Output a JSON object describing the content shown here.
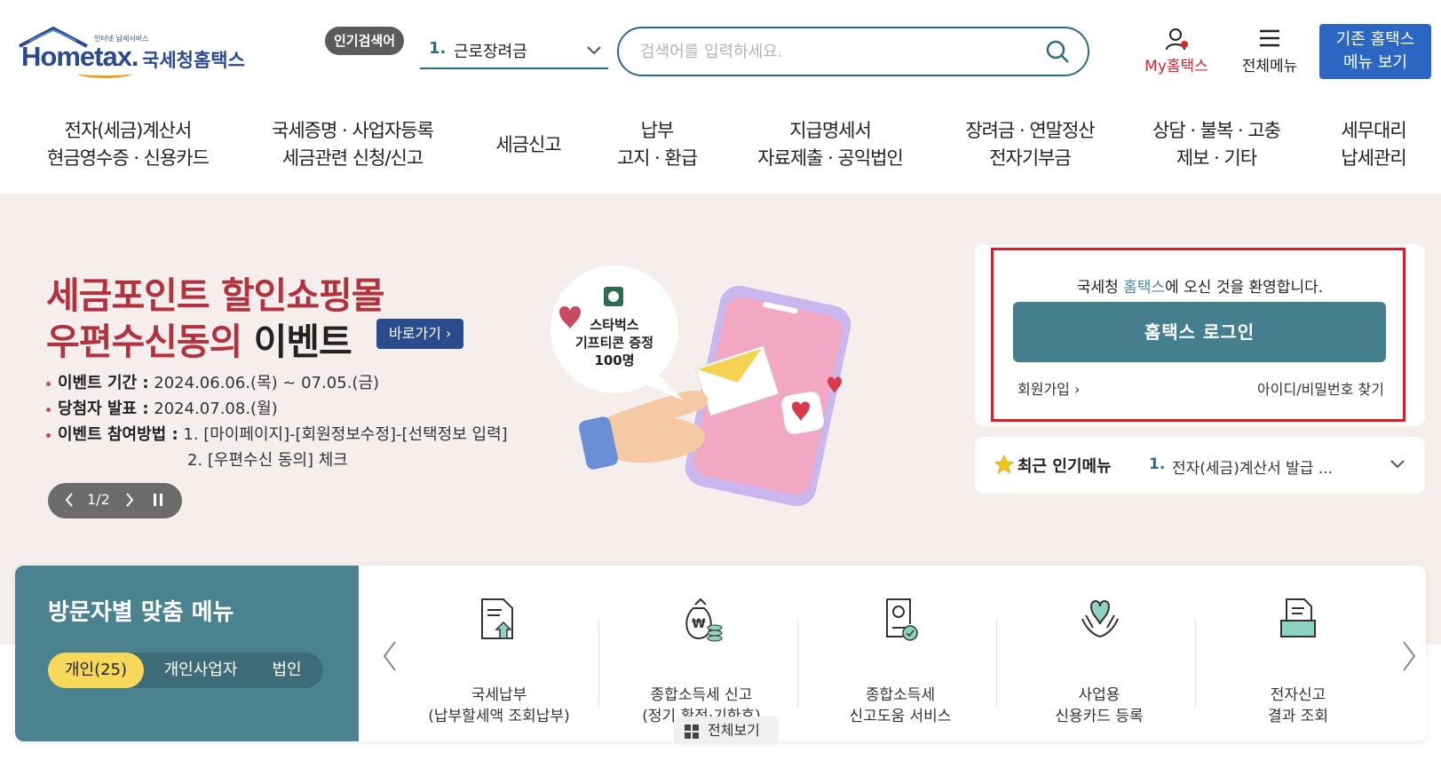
{
  "header": {
    "logo_small": "인터넷 납세서비스",
    "logo_word": "Hometax.",
    "logo_korean": "국세청홈택스",
    "popular_badge": "인기검색어",
    "popular_num": "1.",
    "popular_text": "근로장려금",
    "search_placeholder": "검색어를 입력하세요.",
    "my_label": "My홈택스",
    "allmenu_label": "전체메뉴",
    "old_line1": "기존 홈택스",
    "old_line2": "메뉴 보기"
  },
  "gnb": [
    {
      "l1": "전자(세금)계산서",
      "l2": "현금영수증 · 신용카드"
    },
    {
      "l1": "국세증명 · 사업자등록",
      "l2": "세금관련 신청/신고"
    },
    {
      "l1": "세금신고",
      "l2": ""
    },
    {
      "l1": "납부",
      "l2": "고지 · 환급"
    },
    {
      "l1": "지급명세서",
      "l2": "자료제출 · 공익법인"
    },
    {
      "l1": "장려금 · 연말정산",
      "l2": "전자기부금"
    },
    {
      "l1": "상담 · 불복 · 고충",
      "l2": "제보 · 기타"
    },
    {
      "l1": "세무대리",
      "l2": "납세관리"
    }
  ],
  "hero": {
    "title1": "세금포인트 할인쇼핑몰",
    "title2_red": "우편수신동의",
    "title2_dark": "이벤트",
    "go_label": "바로가기 ›",
    "period_label": "이벤트 기간 :",
    "period_value": "2024.06.06.(목) ~ 07.05.(금)",
    "winner_label": "당첨자 발표 :",
    "winner_value": "2024.07.08.(월)",
    "how_label": "이벤트 참여방법 :",
    "how_value1": "1. [마이페이지]-[회원정보수정]-[선택정보 입력]",
    "how_value2": "2. [우편수신 동의] 체크",
    "pager": "1/2",
    "bubble1": "스타벅스",
    "bubble2": "기프티콘 증정",
    "bubble3": "100명"
  },
  "login": {
    "welcome_pre": "국세청 ",
    "welcome_hl": "홈택스",
    "welcome_post": "에 오신 것을 환영합니다.",
    "login_button": "홈택스 로그인",
    "join": "회원가입 ›",
    "find": "아이디/비밀번호 찾기"
  },
  "recent": {
    "title": "최근 인기메뉴",
    "num": "1.",
    "text": "전자(세금)계산서 발급 ..."
  },
  "visitor": {
    "title": "방문자별 맞춤 메뉴",
    "tabs": [
      "개인(25)",
      "개인사업자",
      "법인"
    ],
    "services": [
      {
        "l1": "국세납부",
        "l2": "(납부할세액 조회납부)",
        "icon": "document-upload-icon"
      },
      {
        "l1": "종합소득세 신고",
        "l2": "(정기 확정·기한후)",
        "icon": "money-bag-icon"
      },
      {
        "l1": "종합소득세",
        "l2": "신고도움 서비스",
        "icon": "certificate-icon"
      },
      {
        "l1": "사업용",
        "l2": "신용카드 등록",
        "icon": "heart-hands-icon"
      },
      {
        "l1": "전자신고",
        "l2": "결과 조회",
        "icon": "document-tray-icon"
      }
    ],
    "view_all": "전체보기"
  },
  "colors": {
    "brand_blue": "#2a4b8d",
    "teal": "#457f8d",
    "hero_bg": "#f5eeed",
    "hero_red": "#b2333d",
    "highlight_red": "#e21b23",
    "tab_yellow": "#f7d85a"
  }
}
